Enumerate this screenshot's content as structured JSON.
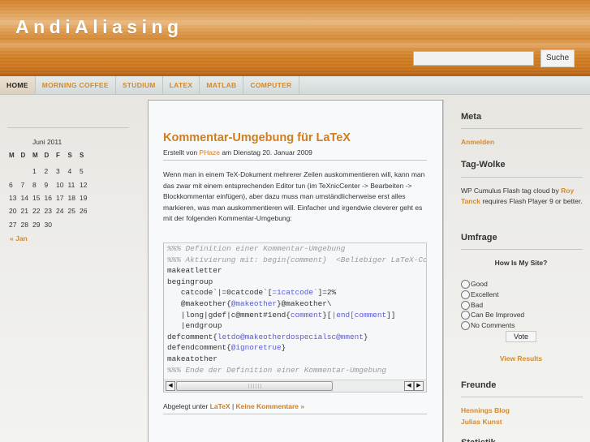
{
  "header": {
    "site_title": "AndiAliasing",
    "search": {
      "placeholder": "",
      "value": "",
      "button_label": "Suche"
    }
  },
  "nav": {
    "items": [
      {
        "label": "HOME",
        "active": true
      },
      {
        "label": "MORNING COFFEE",
        "active": false
      },
      {
        "label": "STUDIUM",
        "active": false
      },
      {
        "label": "LATEX",
        "active": false
      },
      {
        "label": "MATLAB",
        "active": false
      },
      {
        "label": "COMPUTER",
        "active": false
      }
    ]
  },
  "calendar": {
    "caption": "Juni 2011",
    "weekdays": [
      "M",
      "D",
      "M",
      "D",
      "F",
      "S",
      "S"
    ],
    "weeks": [
      [
        "",
        "",
        "1",
        "2",
        "3",
        "4",
        "5"
      ],
      [
        "6",
        "7",
        "8",
        "9",
        "10",
        "11",
        "12"
      ],
      [
        "13",
        "14",
        "15",
        "16",
        "17",
        "18",
        "19"
      ],
      [
        "20",
        "21",
        "22",
        "23",
        "24",
        "25",
        "26"
      ],
      [
        "27",
        "28",
        "29",
        "30",
        "",
        "",
        ""
      ]
    ],
    "prev_link": "« Jan"
  },
  "post": {
    "title": "Kommentar-Umgebung für LaTeX",
    "meta_prefix": "Erstellt von",
    "author": "PHaze",
    "meta_suffix": "am Dienstag 20. Januar 2009",
    "body": "Wenn man in einem TeX-Dokument mehrerer Zeilen auskommentieren will, kann man das zwar mit einem entsprechenden Editor tun (im TeXnicCenter -> Bearbeiten -> Blockkommentar einfügen), aber dazu muss man umständlicherweise erst alles markieren, was man auskommentieren will. Einfacher und irgendwie cleverer geht es mit der folgenden Kommentar-Umgebung:",
    "code_lines": [
      [
        {
          "t": "%%% Definition einer Kommentar-Umgebung",
          "c": "cm"
        }
      ],
      [
        {
          "t": "%%% Aktivierung mit: begin{comment}  <Beliebiger LaTeX-Code> end{comment}",
          "c": "cm"
        }
      ],
      [
        {
          "t": "makeatletter",
          "c": ""
        }
      ],
      [
        {
          "t": "begingroup",
          "c": ""
        }
      ],
      [
        {
          "t": "   catcode`|=0catcode`[",
          "c": ""
        },
        {
          "t": "=1catcode`",
          "c": "kw"
        },
        {
          "t": "]=2%",
          "c": ""
        }
      ],
      [
        {
          "t": "   @makeother{",
          "c": ""
        },
        {
          "t": "@makeother",
          "c": "kw"
        },
        {
          "t": "}@makeother\\",
          "c": ""
        }
      ],
      [
        {
          "t": "   |long|gdef|c@mment#1end{",
          "c": ""
        },
        {
          "t": "comment",
          "c": "kw"
        },
        {
          "t": "}[",
          "c": ""
        },
        {
          "t": "|end[comment",
          "c": "kw"
        },
        {
          "t": "]]",
          "c": ""
        }
      ],
      [
        {
          "t": "   |endgroup",
          "c": ""
        }
      ],
      [
        {
          "t": "defcomment{",
          "c": ""
        },
        {
          "t": "letdo@makeotherdospecialsc@mment",
          "c": "kw"
        },
        {
          "t": "}",
          "c": ""
        }
      ],
      [
        {
          "t": "defendcomment{",
          "c": ""
        },
        {
          "t": "@ignoretrue",
          "c": "kw"
        },
        {
          "t": "}",
          "c": ""
        }
      ],
      [
        {
          "t": "makeatother",
          "c": ""
        }
      ],
      [
        {
          "t": "%%% Ende der Definition einer Kommentar-Umgebung",
          "c": "cm"
        }
      ]
    ],
    "footer_prefix": "Abgelegt unter",
    "category": "LaTeX",
    "separator": "|",
    "comments_link": "Keine Kommentare »"
  },
  "sidebar": {
    "meta": {
      "title": "Meta",
      "links": [
        "Anmelden"
      ]
    },
    "tag_cloud": {
      "title": "Tag-Wolke",
      "text_before": "WP Cumulus Flash tag cloud by",
      "link": "Roy Tanck",
      "text_after": "requires Flash Player 9 or better."
    },
    "poll": {
      "title": "Umfrage",
      "question": "How Is My Site?",
      "options": [
        "Good",
        "Excellent",
        "Bad",
        "Can Be Improved",
        "No Comments"
      ],
      "vote_label": "Vote",
      "results_link": "View Results"
    },
    "friends": {
      "title": "Freunde",
      "links": [
        "Hennings Blog",
        "Julias Kunst"
      ]
    },
    "next_title_partial": "Statistik"
  },
  "colors": {
    "accent": "#cf7e1f",
    "header_orange": "#d07c22",
    "code_keyword": "#5a5ad0"
  }
}
